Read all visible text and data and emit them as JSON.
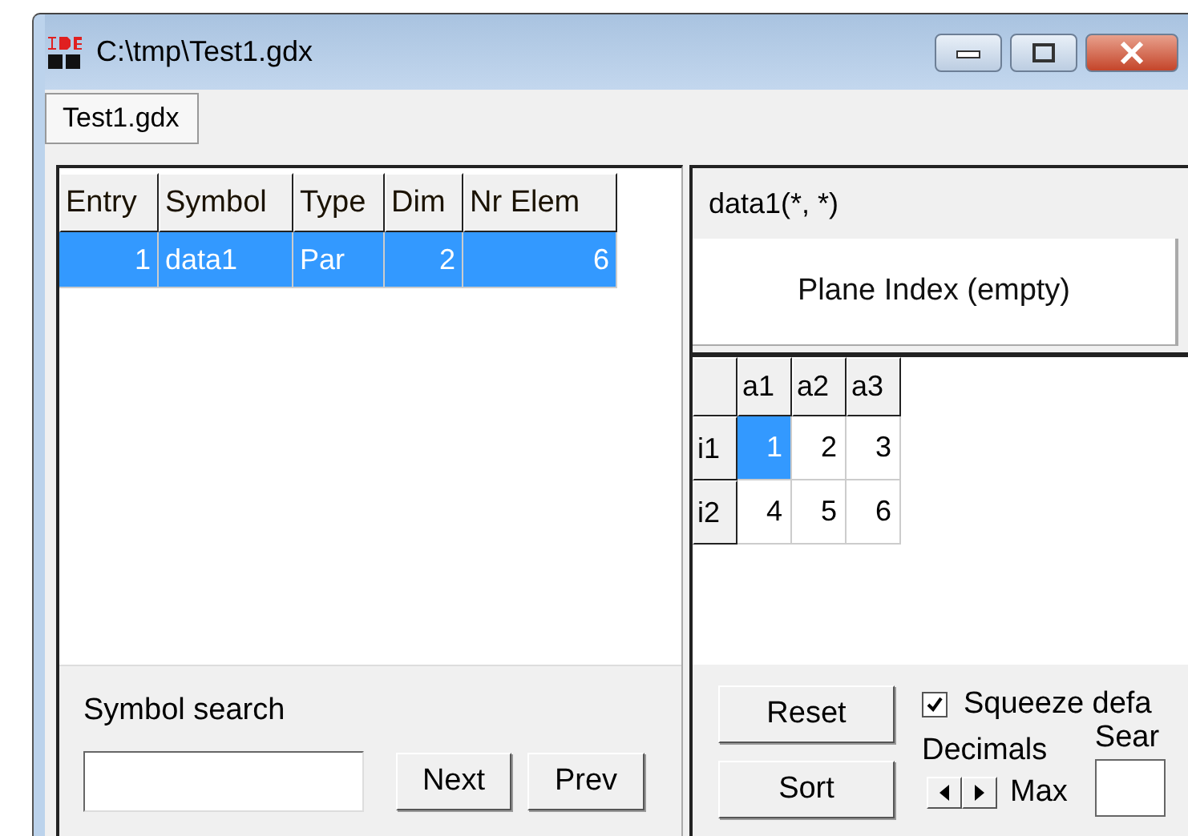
{
  "window": {
    "title": "C:\\tmp\\Test1.gdx"
  },
  "tabs": [
    {
      "label": "Test1.gdx",
      "selected": true
    }
  ],
  "symbol_table": {
    "columns": [
      {
        "label": "Entry",
        "kind": "number"
      },
      {
        "label": "Symbol",
        "kind": "text"
      },
      {
        "label": "Type",
        "kind": "text"
      },
      {
        "label": "Dim",
        "kind": "number"
      },
      {
        "label": "Nr Elem",
        "kind": "number"
      }
    ],
    "rows": [
      {
        "cells": [
          "1",
          "data1",
          "Par",
          "2",
          "6"
        ],
        "selected": true
      }
    ]
  },
  "symbol_search": {
    "label": "Symbol search",
    "buttons": [
      "Next",
      "Prev"
    ]
  },
  "data_view": {
    "title": "data1(*, *)",
    "plane_index": "Plane Index (empty)",
    "grid": {
      "columns": [
        "a1",
        "a2",
        "a3"
      ],
      "rows": [
        {
          "label": "i1",
          "cells": [
            {
              "value": "1",
              "selected": true
            },
            {
              "value": "2",
              "selected": false
            },
            {
              "value": "3",
              "selected": false
            }
          ]
        },
        {
          "label": "i2",
          "cells": [
            {
              "value": "4",
              "selected": false
            },
            {
              "value": "5",
              "selected": false
            },
            {
              "value": "6",
              "selected": false
            }
          ]
        }
      ]
    }
  },
  "controls": {
    "buttons": [
      "Reset",
      "Sort"
    ],
    "squeeze": {
      "label": "Squeeze defa",
      "checked": true
    },
    "decimals_label": "Decimals",
    "max_label": "Max",
    "search_label": "Sear"
  }
}
